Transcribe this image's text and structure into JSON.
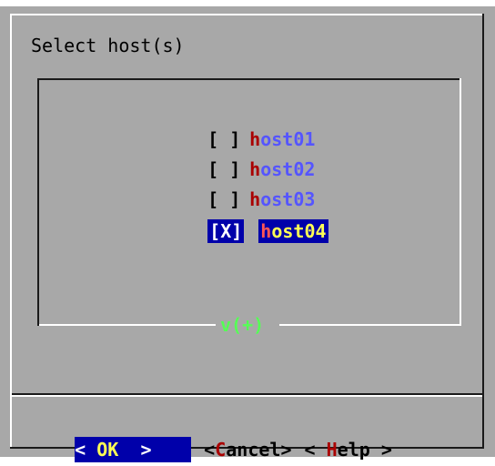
{
  "dialog": {
    "title": "Select host(s)"
  },
  "list": {
    "items": [
      {
        "checkbox": "[ ]",
        "hotkey": "h",
        "rest": "ost01",
        "selected": false
      },
      {
        "checkbox": "[ ]",
        "hotkey": "h",
        "rest": "ost02",
        "selected": false
      },
      {
        "checkbox": "[ ]",
        "hotkey": "h",
        "rest": "ost03",
        "selected": false
      },
      {
        "checkbox": "[X]",
        "hotkey": "h",
        "rest": "ost04",
        "selected": true
      }
    ],
    "more_indicator": "v(+)"
  },
  "buttons": {
    "ok": {
      "left": "< ",
      "hotkey": "OK",
      "right": "  >"
    },
    "cancel": {
      "left": "<",
      "hotkey": "C",
      "rest": "ancel>"
    },
    "help": {
      "left": "< ",
      "hotkey": "H",
      "rest": "elp >"
    }
  },
  "colors": {
    "dialog_bg": "#a8a8a8",
    "selection_bg": "#0000aa",
    "item_text": "#5555ff",
    "hotkey": "#aa0000",
    "selected_text": "#ffff55",
    "more_indicator": "#55ff55"
  }
}
